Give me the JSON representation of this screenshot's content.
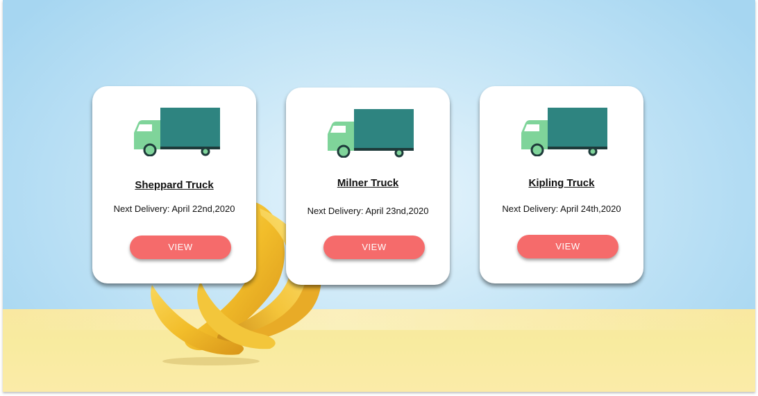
{
  "colors": {
    "sky": "#a6d6f1",
    "ground": "#f9e8a0",
    "truck_cargo": "#2e8480",
    "truck_cab": "#7fd49a",
    "button": "#f56b6b",
    "card": "#ffffff"
  },
  "background": {
    "icon": "banana-bunch-photo"
  },
  "cards": [
    {
      "title": "Sheppard Truck",
      "subtitle": "Next Delivery: April 22nd,2020",
      "button": "VIEW",
      "icon": "truck-icon"
    },
    {
      "title": "Milner Truck",
      "subtitle": "Next Delivery: April 23nd,2020",
      "button": "VIEW",
      "icon": "truck-icon"
    },
    {
      "title": "Kipling Truck",
      "subtitle": "Next Delivery: April 24th,2020",
      "button": "VIEW",
      "icon": "truck-icon"
    }
  ]
}
